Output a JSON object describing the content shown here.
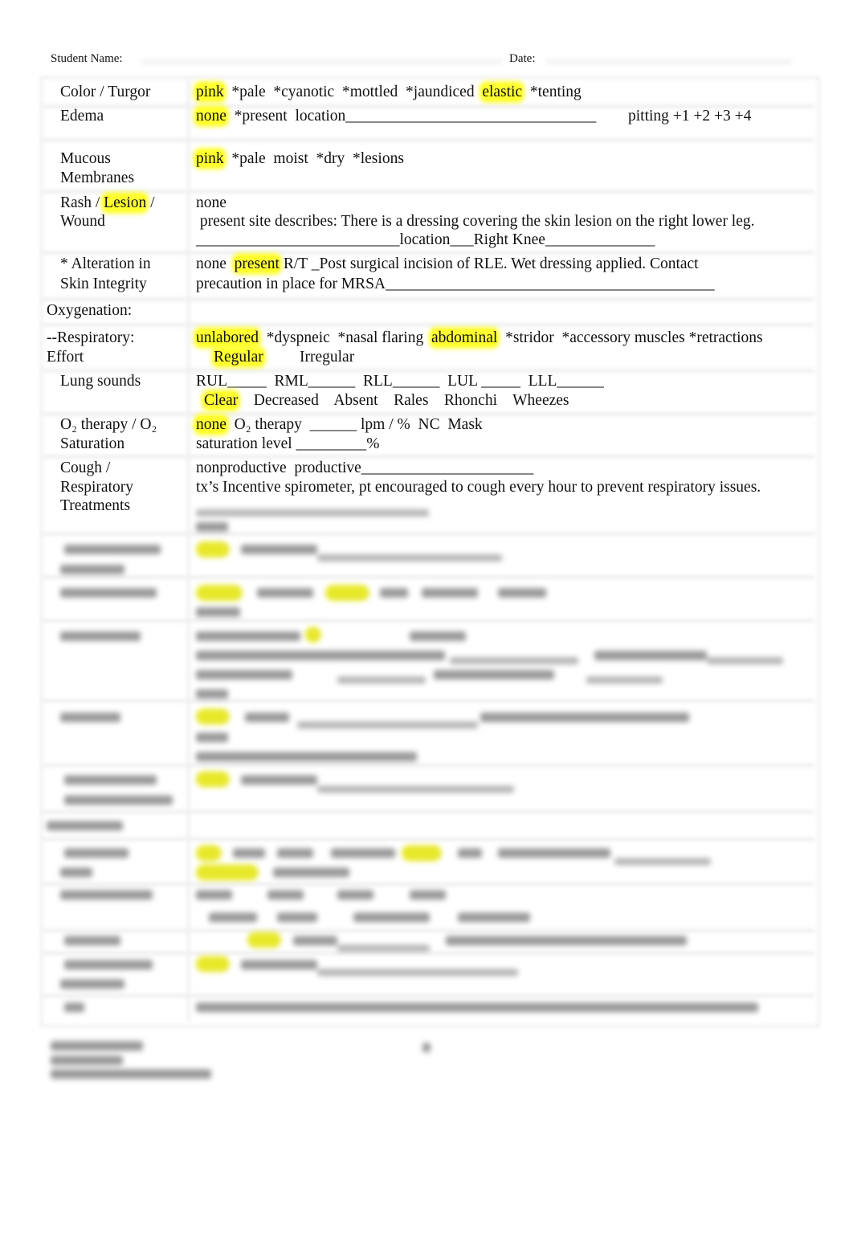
{
  "header": {
    "student_name_label": "Student Name:",
    "date_label": "Date:"
  },
  "highlight_color": "#ffff30",
  "rows": {
    "color_turgor": {
      "label": "Color / Turgor",
      "selected1": "pink",
      "options1": "*pale  *cyanotic  *mottled  *jaundiced",
      "selected2": "elastic",
      "options2": "*tenting"
    },
    "edema": {
      "label": "Edema",
      "selected": "none",
      "options": "*present  location________________________________",
      "pitting": "pitting +1 +2 +3 +4"
    },
    "mucous": {
      "label_line1": "Mucous",
      "label_line2": "Membranes",
      "selected": "pink",
      "options": "*pale  moist  *dry  *lesions"
    },
    "rash": {
      "label_part1": "Rash / ",
      "label_highlight": "Lesion",
      "label_part2": " /",
      "label_line2": "Wound",
      "line1": "none",
      "line2": " present site describes: There is a dressing covering the skin lesion on the right lower leg.",
      "line3": "__________________________location___Right Knee______________"
    },
    "alteration": {
      "label_line1": "* Alteration in",
      "label_line2": "Skin Integrity",
      "prefix": "none ",
      "selected": "present",
      "line1_rest": " R/T _Post surgical incision of RLE. Wet dressing applied. Contact",
      "line2": "precaution in place for MRSA__________________________________________"
    },
    "oxygenation_heading": "Oxygenation:",
    "resp_effort": {
      "label_line1": "--Respiratory:",
      "label_line2": "Effort",
      "selected1": "unlabored",
      "options1": "*dyspneic  *nasal flaring",
      "selected2": "abdominal",
      "options2": "*stridor  *accessory muscles *retractions",
      "selected3": "Regular",
      "option3": "Irregular"
    },
    "lung_sounds": {
      "label": "Lung sounds",
      "lobes": "RUL_____  RML______  RLL______  LUL _____  LLL______",
      "selected": "Clear",
      "options": "Decreased    Absent    Rales    Rhonchi    Wheezes"
    },
    "o2": {
      "label_line1": "O₂ therapy / O₂",
      "label_line2": "Saturation",
      "selected": "none",
      "options": "O₂ therapy  ______ lpm / %  NC  Mask",
      "line2": "saturation level _________%"
    },
    "cough": {
      "label_line1": "Cough /",
      "label_line2": "Respiratory",
      "label_line3": "Treatments",
      "line1": "nonproductive  productive______________________",
      "line2": "tx’s Incentive spirometer, pt encouraged to cough every hour to prevent respiratory issues."
    }
  }
}
